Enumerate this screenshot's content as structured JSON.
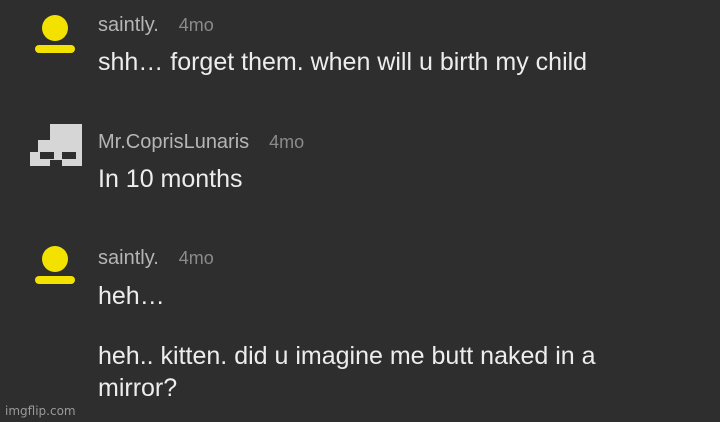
{
  "comments": [
    {
      "username": "saintly.",
      "time": "4mo",
      "avatar_icon": "user-icon-yellow",
      "texts": [
        "shh… forget them. when will u birth my child"
      ]
    },
    {
      "username": "Mr.CoprisLunaris",
      "time": "4mo",
      "avatar_icon": "pixel-robot-icon",
      "texts": [
        "In 10 months"
      ]
    },
    {
      "username": "saintly.",
      "time": "4mo",
      "avatar_icon": "user-icon-yellow",
      "texts": [
        "heh…",
        "heh.. kitten. did u imagine me butt naked in a mirror?"
      ]
    }
  ],
  "colors": {
    "background": "#2e2e2f",
    "avatar_yellow": "#f3e100",
    "username": "#b5b5b5",
    "time": "#8b8b8b",
    "text": "#ededed"
  },
  "watermark": "imgflip.com"
}
